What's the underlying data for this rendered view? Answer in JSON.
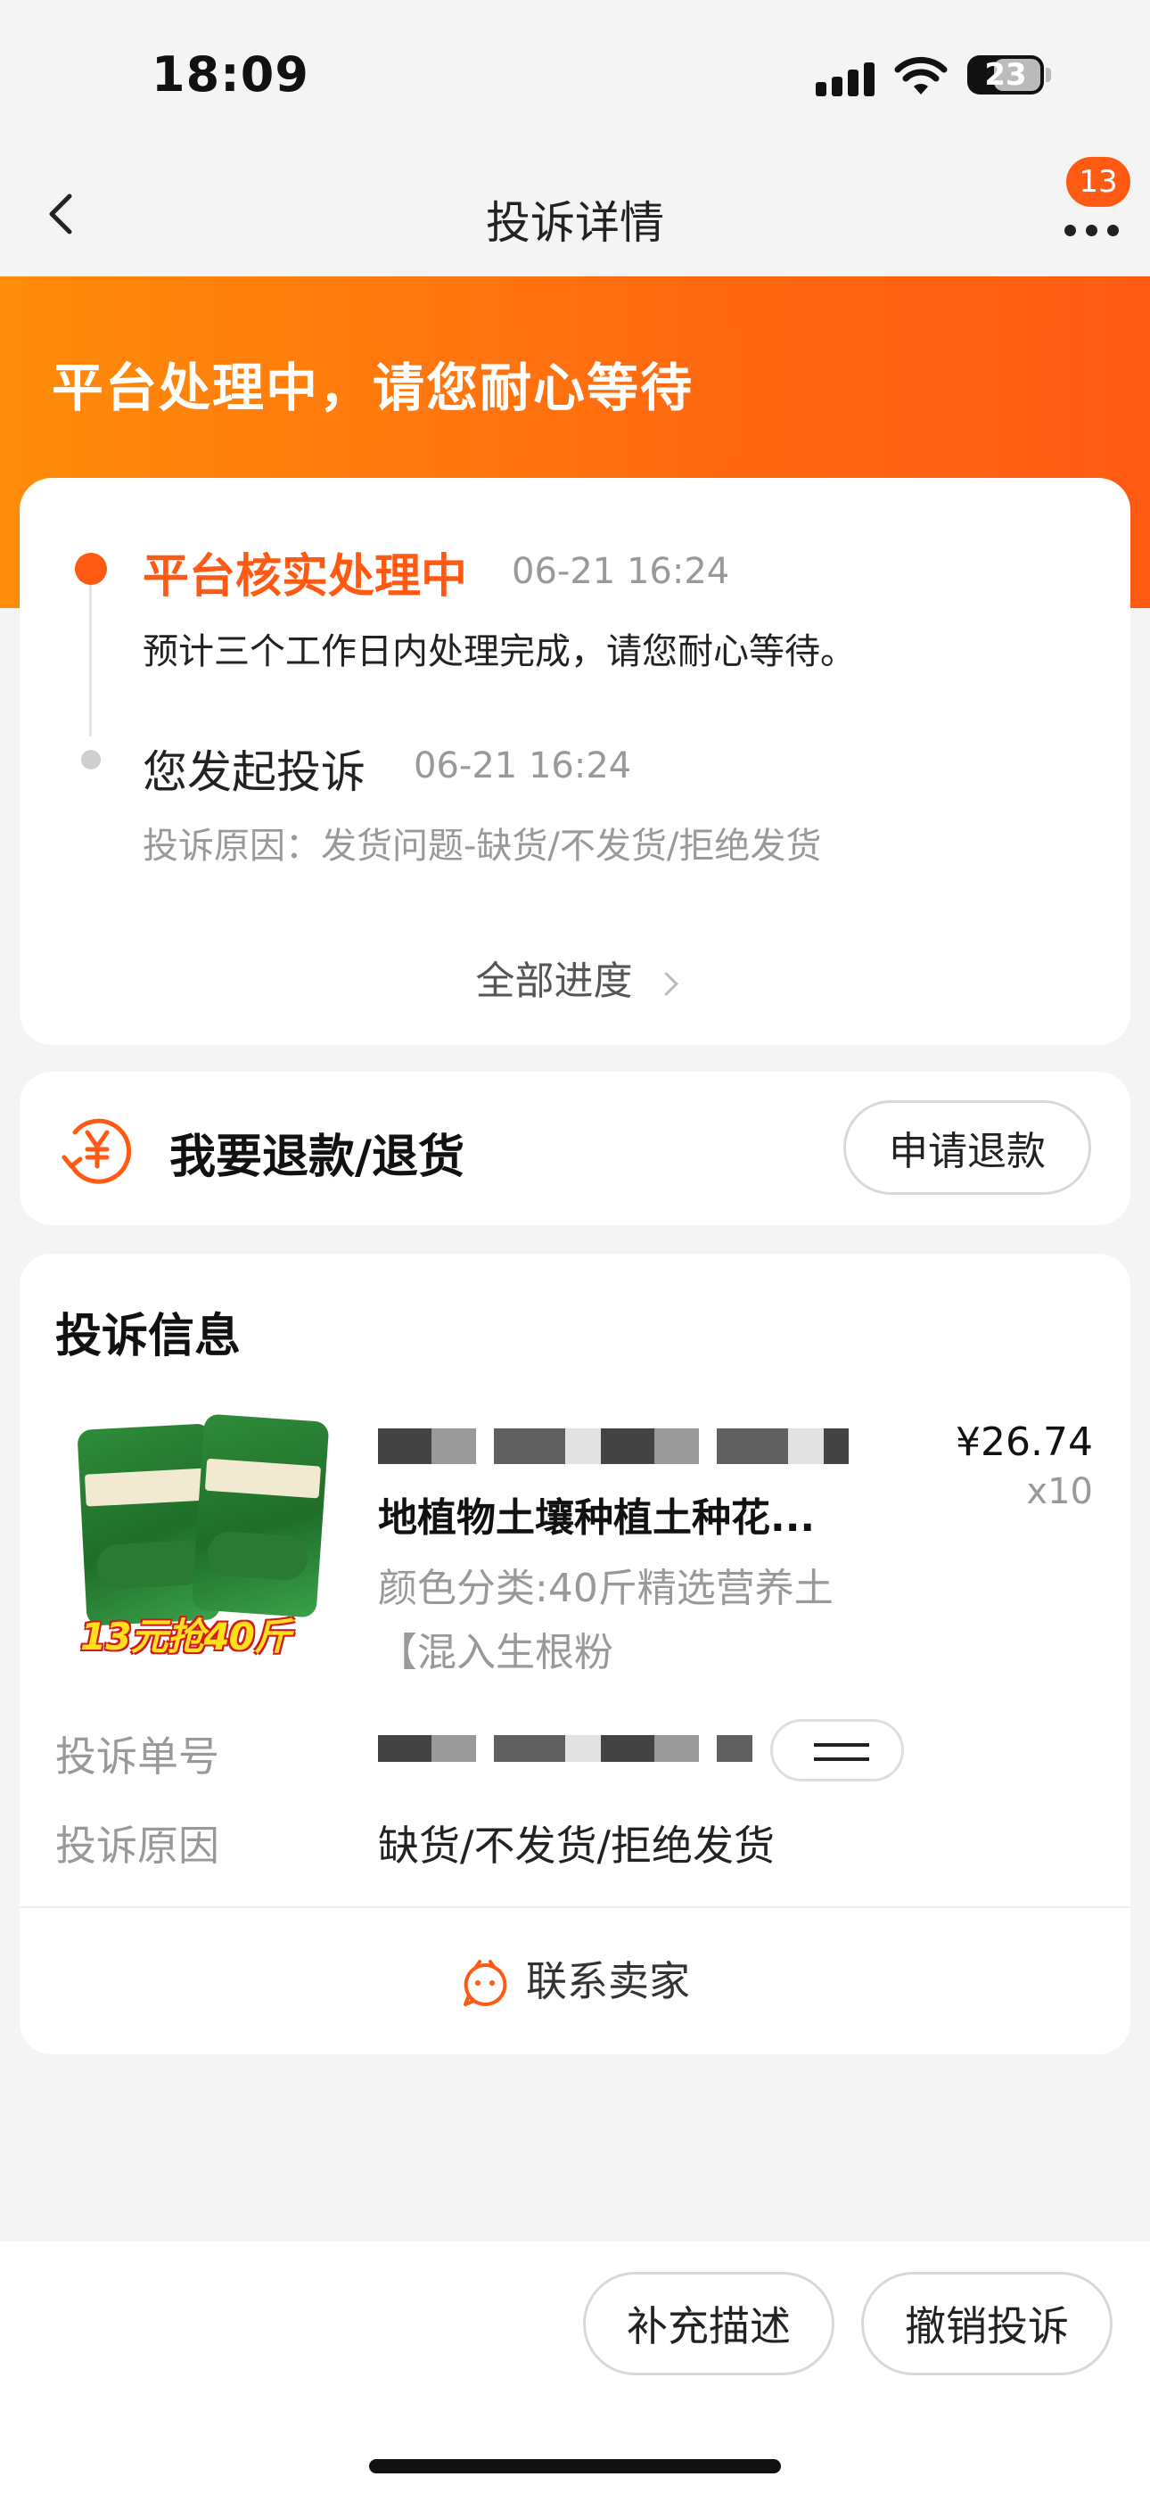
{
  "status_bar": {
    "time": "18:09",
    "battery": "23"
  },
  "nav": {
    "title": "投诉详情",
    "badge_count": "13",
    "icons": {
      "back": "chevron-left-icon",
      "more": "more-dots-icon"
    }
  },
  "header": {
    "status_text": "平台处理中，请您耐心等待",
    "gradient": [
      "#ff8c0a",
      "#ff5a14"
    ]
  },
  "progress": {
    "steps": [
      {
        "title": "平台核实处理中",
        "time": "06-21 16:24",
        "desc": "预计三个工作日内处理完成，请您耐心等待。"
      },
      {
        "title": "您发起投诉",
        "time": "06-21 16:24",
        "desc": "投诉原因：发货问题-缺货/不发货/拒绝发货"
      }
    ],
    "all_progress_label": "全部进度"
  },
  "refund": {
    "label": "我要退款/退货",
    "button_label": "申请退款",
    "icon": "yen-refund-icon"
  },
  "complaint_info": {
    "title": "投诉信息",
    "product": {
      "image_promo": "13元抢40斤",
      "name": "地植物土壤种植土种花...",
      "spec": "颜色分类:40斤精选营养土【混入生根粉",
      "price": "¥26.74",
      "quantity": "x10"
    },
    "rows": [
      {
        "label": "投诉单号",
        "value": ""
      },
      {
        "label": "投诉原因",
        "value": "缺货/不发货/拒绝发货"
      }
    ],
    "contact_label": "联系卖家"
  },
  "bottom": {
    "supplement_label": "补充描述",
    "withdraw_label": "撤销投诉"
  },
  "colors": {
    "accent": "#ff5a14",
    "background": "#f4f4f4"
  }
}
